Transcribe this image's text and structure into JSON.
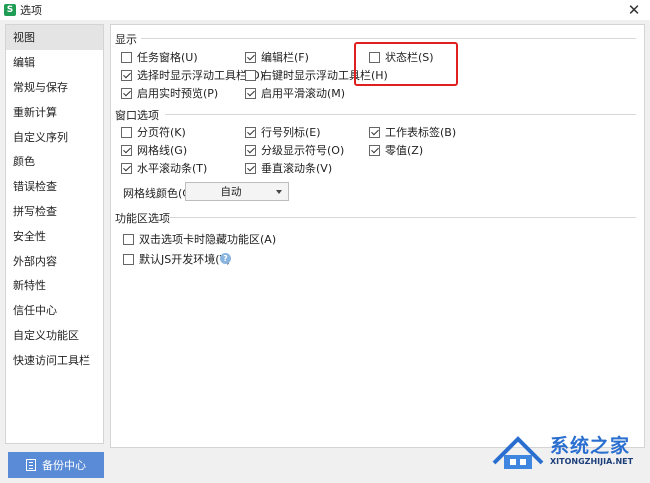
{
  "window": {
    "title": "选项",
    "app_icon": "S",
    "close_glyph": "✕"
  },
  "sidebar": {
    "items": [
      {
        "label": "视图",
        "active": true
      },
      {
        "label": "编辑"
      },
      {
        "label": "常规与保存"
      },
      {
        "label": "重新计算"
      },
      {
        "label": "自定义序列"
      },
      {
        "label": "颜色"
      },
      {
        "label": "错误检查"
      },
      {
        "label": "拼写检查"
      },
      {
        "label": "安全性"
      },
      {
        "label": "外部内容"
      },
      {
        "label": "新特性"
      },
      {
        "label": "信任中心"
      },
      {
        "label": "自定义功能区"
      },
      {
        "label": "快速访问工具栏"
      }
    ]
  },
  "backup_button": {
    "label": "备份中心"
  },
  "display": {
    "title": "显示",
    "options": [
      {
        "label": "任务窗格(U)",
        "checked": false
      },
      {
        "label": "选择时显示浮动工具栏(D)",
        "checked": true
      },
      {
        "label": "启用实时预览(P)",
        "checked": true
      },
      {
        "label": "编辑栏(F)",
        "checked": true
      },
      {
        "label": "右键时显示浮动工具栏(H)",
        "checked": false
      },
      {
        "label": "启用平滑滚动(M)",
        "checked": true
      },
      {
        "label": "状态栏(S)",
        "checked": false
      }
    ]
  },
  "window_options": {
    "title": "窗口选项",
    "options": [
      {
        "label": "分页符(K)",
        "checked": false
      },
      {
        "label": "网格线(G)",
        "checked": true
      },
      {
        "label": "水平滚动条(T)",
        "checked": true
      },
      {
        "label": "行号列标(E)",
        "checked": true
      },
      {
        "label": "分级显示符号(O)",
        "checked": true
      },
      {
        "label": "垂直滚动条(V)",
        "checked": true
      },
      {
        "label": "工作表标签(B)",
        "checked": true
      },
      {
        "label": "零值(Z)",
        "checked": true
      }
    ],
    "grid_color_label": "网格线颜色(C):",
    "grid_color_value": "自动"
  },
  "ribbon": {
    "title": "功能区选项",
    "options": [
      {
        "label": "双击选项卡时隐藏功能区(A)",
        "checked": false
      },
      {
        "label": "默认JS开发环境(Y)",
        "checked": false
      }
    ],
    "help_glyph": "?"
  },
  "watermark": {
    "text": "系统之家",
    "sub": "XITONGZHIJIA.NET"
  },
  "colors": {
    "highlight": "#e02020",
    "backup_button": "#5a8bd6",
    "brand_blue": "#2a6fd0"
  }
}
